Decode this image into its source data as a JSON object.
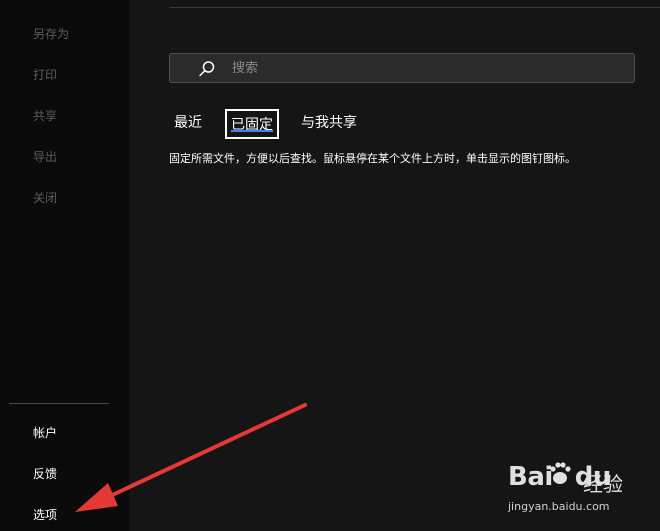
{
  "sidebar": {
    "items": [
      {
        "label": "另存为"
      },
      {
        "label": "打印"
      },
      {
        "label": "共享"
      },
      {
        "label": "导出"
      },
      {
        "label": "关闭"
      }
    ],
    "bottom_items": [
      {
        "label": "帐户"
      },
      {
        "label": "反馈"
      },
      {
        "label": "选项"
      }
    ]
  },
  "search": {
    "placeholder": "搜索"
  },
  "tabs": [
    {
      "label": "最近",
      "active": false
    },
    {
      "label": "已固定",
      "active": true
    },
    {
      "label": "与我共享",
      "active": false
    }
  ],
  "description": "固定所需文件，方便以后查找。鼠标悬停在某个文件上方时，单击显示的图钉图标。",
  "annotation": {
    "arrow_color": "#e53935"
  },
  "watermark": {
    "logo": "Bai",
    "logo_tail": "du",
    "cn": "经验",
    "url": "jingyan.baidu.com"
  },
  "colors": {
    "accent": "#3b82f6",
    "sidebar_bg": "#0a0a0a",
    "main_bg": "#151515"
  }
}
